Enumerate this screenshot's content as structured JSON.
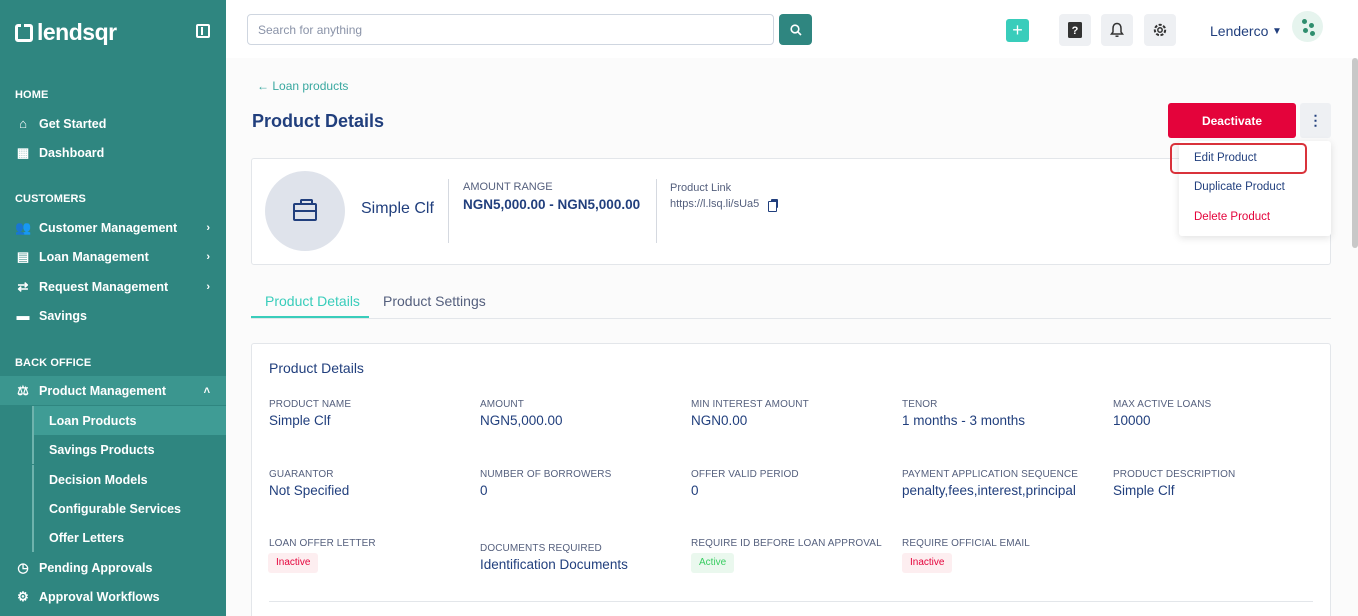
{
  "brand": {
    "name": "lendsqr"
  },
  "sidebar": {
    "sections": [
      {
        "title": "HOME"
      },
      {
        "title": "CUSTOMERS"
      },
      {
        "title": "BACK OFFICE"
      }
    ],
    "items": [
      {
        "label": "Get Started",
        "icon": "home-icon"
      },
      {
        "label": "Dashboard",
        "icon": "dashboard-icon"
      },
      {
        "label": "Customer Management",
        "icon": "users-icon"
      },
      {
        "label": "Loan Management",
        "icon": "loan-icon"
      },
      {
        "label": "Request Management",
        "icon": "request-icon"
      },
      {
        "label": "Savings",
        "icon": "briefcase-icon"
      },
      {
        "label": "Product Management",
        "icon": "product-icon"
      },
      {
        "label": "Pending Approvals",
        "icon": "clock-icon"
      },
      {
        "label": "Approval Workflows",
        "icon": "workflow-icon"
      }
    ],
    "sub_items": [
      {
        "label": "Loan Products"
      },
      {
        "label": "Savings Products"
      },
      {
        "label": "Decision Models"
      },
      {
        "label": "Configurable Services"
      },
      {
        "label": "Offer Letters"
      }
    ]
  },
  "topbar": {
    "search_placeholder": "Search for anything",
    "user_name": "Lenderco"
  },
  "page": {
    "back_label": "Loan products",
    "title": "Product Details",
    "deactivate_label": "Deactivate",
    "menu": {
      "edit": "Edit Product",
      "duplicate": "Duplicate Product",
      "delete": "Delete Product"
    }
  },
  "summary": {
    "product_name": "Simple Clf",
    "amount_range_label": "AMOUNT RANGE",
    "amount_range": "NGN5,000.00 - NGN5,000.00",
    "link_label": "Product Link",
    "link_value": "https://l.lsq.li/sUa5"
  },
  "tabs": [
    {
      "label": "Product Details"
    },
    {
      "label": "Product Settings"
    }
  ],
  "details": {
    "title": "Product Details",
    "fields": [
      {
        "label": "PRODUCT NAME",
        "value": "Simple Clf"
      },
      {
        "label": "AMOUNT",
        "value": "NGN5,000.00"
      },
      {
        "label": "MIN INTEREST AMOUNT",
        "value": "NGN0.00"
      },
      {
        "label": "TENOR",
        "value": "1 months - 3 months"
      },
      {
        "label": "MAX ACTIVE LOANS",
        "value": "10000"
      },
      {
        "label": "GUARANTOR",
        "value": "Not Specified"
      },
      {
        "label": "NUMBER OF BORROWERS",
        "value": "0"
      },
      {
        "label": "OFFER VALID PERIOD",
        "value": "0"
      },
      {
        "label": "PAYMENT APPLICATION SEQUENCE",
        "value": "penalty,fees,interest,principal"
      },
      {
        "label": "PRODUCT DESCRIPTION",
        "value": "Simple Clf"
      },
      {
        "label": "LOAN OFFER LETTER",
        "value": "Inactive"
      },
      {
        "label": "DOCUMENTS REQUIRED",
        "value": "Identification Documents"
      },
      {
        "label": "REQUIRE ID BEFORE LOAN APPROVAL",
        "value": "Active"
      },
      {
        "label": "REQUIRE OFFICIAL EMAIL",
        "value": "Inactive"
      }
    ]
  },
  "colors": {
    "sidebar_bg": "#2f8680",
    "accent": "#39cdbb",
    "danger": "#e4033b",
    "text": "#213f7d"
  }
}
